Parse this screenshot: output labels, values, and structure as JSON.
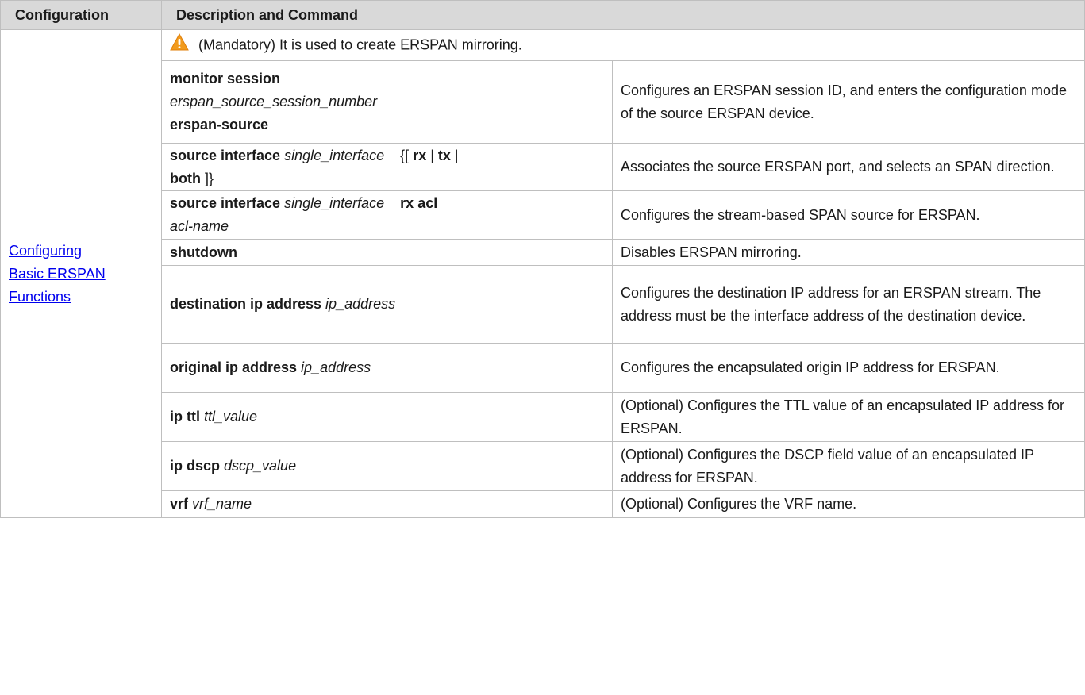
{
  "header": {
    "col1": "Configuration",
    "col2": "Description and Command"
  },
  "config_link": {
    "line1": "Configuring ",
    "line2": "Basic ERSPAN ",
    "line3": "Functions"
  },
  "note": {
    "text": "(Mandatory) It is used to create ERSPAN mirroring.",
    "icon": "warning-icon",
    "icon_color": "#f29b1d"
  },
  "rows": [
    {
      "cmd": [
        [
          {
            "t": "monitor session",
            "s": "kw"
          }
        ],
        [
          {
            "t": "erspan_source_session_number",
            "s": "arg"
          }
        ],
        [
          {
            "t": "erspan-source",
            "s": "kw"
          }
        ]
      ],
      "desc": "Configures an ERSPAN session ID, and enters the configuration mode of the source ERSPAN device."
    },
    {
      "cmd": [
        [
          {
            "t": "source interface ",
            "s": "kw"
          },
          {
            "t": "single_interface",
            "s": "arg"
          },
          {
            "t": "    {[ ",
            "s": ""
          },
          {
            "t": "rx",
            "s": "kw"
          },
          {
            "t": " | ",
            "s": ""
          },
          {
            "t": "tx",
            "s": "kw"
          },
          {
            "t": " |",
            "s": ""
          }
        ],
        [
          {
            "t": "both",
            "s": "kw"
          },
          {
            "t": " ]}",
            "s": ""
          }
        ]
      ],
      "desc": "Associates the source ERSPAN port, and selects an SPAN direction."
    },
    {
      "cmd": [
        [
          {
            "t": "source interface ",
            "s": "kw"
          },
          {
            "t": "single_interface",
            "s": "arg"
          },
          {
            "t": "    ",
            "s": ""
          },
          {
            "t": "rx acl",
            "s": "kw"
          }
        ],
        [
          {
            "t": "acl-name",
            "s": "arg"
          }
        ]
      ],
      "desc": "Configures the stream-based SPAN source for ERSPAN."
    },
    {
      "cmd": [
        [
          {
            "t": "shutdown",
            "s": "kw"
          }
        ]
      ],
      "desc": "Disables ERSPAN mirroring."
    },
    {
      "cmd": [
        [
          {
            "t": "destination ip address ",
            "s": "kw"
          },
          {
            "t": "ip_address",
            "s": "arg"
          }
        ]
      ],
      "desc": "Configures the destination IP address for an ERSPAN stream. The address must be the interface address of the destination device."
    },
    {
      "cmd": [
        [
          {
            "t": "original ip address ",
            "s": "kw"
          },
          {
            "t": "ip_address",
            "s": "arg"
          }
        ]
      ],
      "desc": "Configures the encapsulated origin IP address for ERSPAN."
    },
    {
      "cmd": [
        [
          {
            "t": "ip ttl ",
            "s": "kw"
          },
          {
            "t": "ttl_value",
            "s": "arg"
          }
        ]
      ],
      "desc": "(Optional) Configures the TTL value of an encapsulated IP address for ERSPAN."
    },
    {
      "cmd": [
        [
          {
            "t": "ip dscp ",
            "s": "kw"
          },
          {
            "t": "dscp_value",
            "s": "arg"
          }
        ]
      ],
      "desc": "(Optional) Configures the DSCP field value of an encapsulated IP address for ERSPAN."
    },
    {
      "cmd": [
        [
          {
            "t": "vrf ",
            "s": "kw"
          },
          {
            "t": "vrf_name",
            "s": "arg"
          }
        ]
      ],
      "desc": "(Optional) Configures the VRF name."
    }
  ]
}
